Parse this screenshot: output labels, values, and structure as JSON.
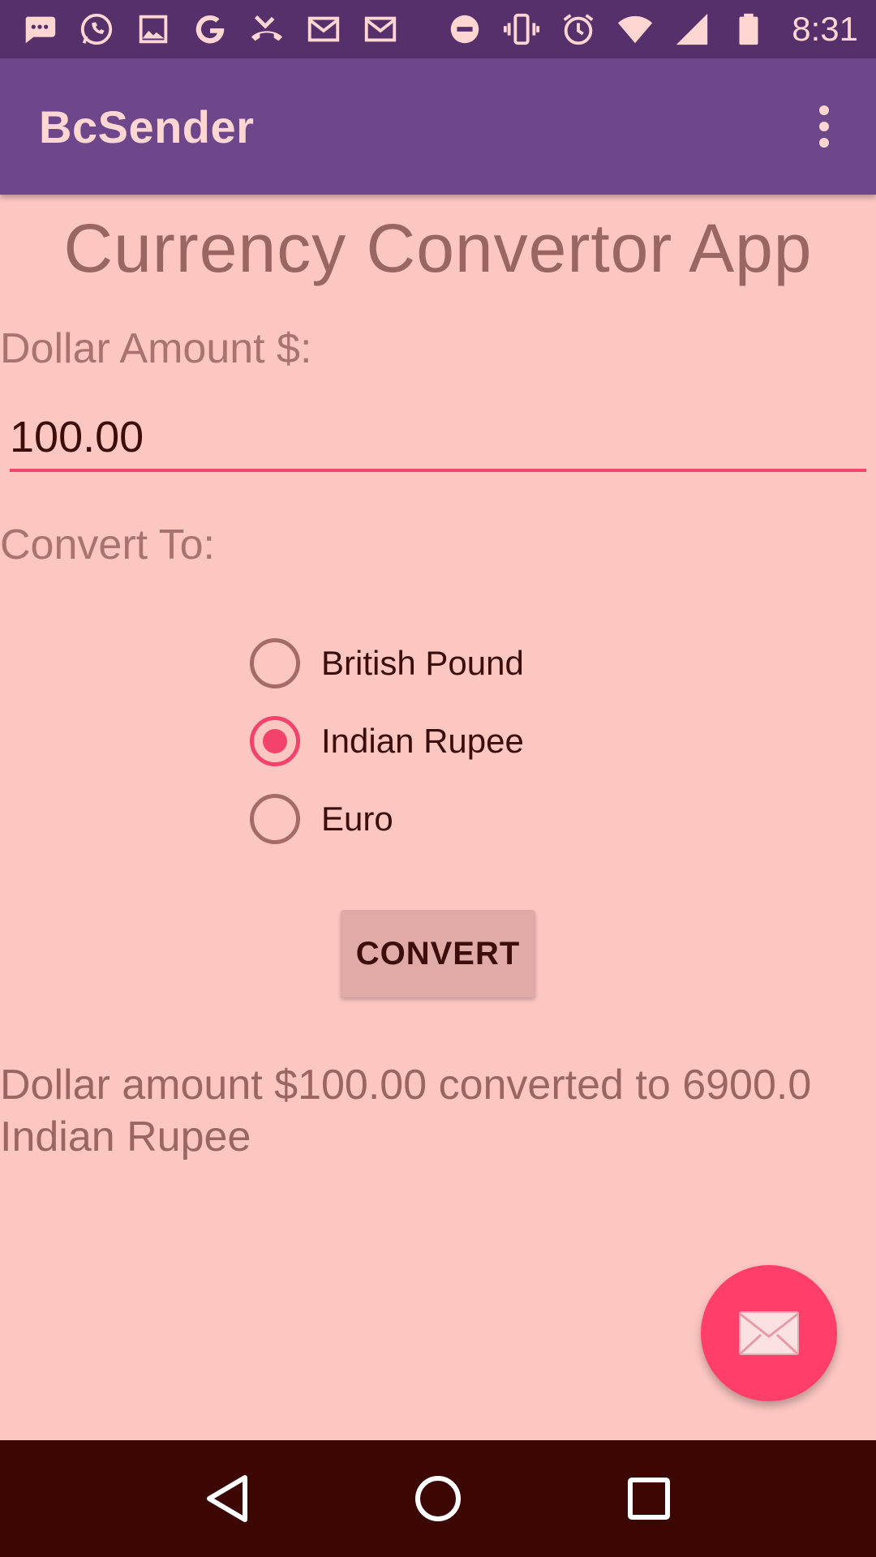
{
  "status_bar": {
    "time": "8:31",
    "left_icons": [
      "messages-icon",
      "whatsapp-icon",
      "gallery-icon",
      "google-icon",
      "missed-call-icon",
      "gmail-icon",
      "gmail-icon-2"
    ],
    "right_icons": [
      "do-not-disturb-icon",
      "vibrate-icon",
      "alarm-icon",
      "wifi-icon",
      "signal-icon",
      "battery-icon"
    ]
  },
  "app_bar": {
    "title": "BcSender",
    "overflow_icon": "more-vert-icon"
  },
  "main": {
    "heading": "Currency Convertor App",
    "amount_label": "Dollar Amount $:",
    "amount_value": "100.00",
    "convert_to_label": "Convert To:",
    "currency_options": [
      {
        "label": "British Pound",
        "checked": false
      },
      {
        "label": "Indian Rupee",
        "checked": true
      },
      {
        "label": "Euro",
        "checked": false
      }
    ],
    "convert_button": "CONVERT",
    "result": "Dollar amount $100.00 converted to 6900.0 Indian Rupee"
  },
  "fab": {
    "icon": "mail-icon"
  },
  "nav_bar": {
    "icons": [
      "back-icon",
      "home-icon",
      "recents-icon"
    ]
  },
  "colors": {
    "status_bar": "#56306a",
    "app_bar": "#6d4789",
    "background": "#fcc6c1",
    "accent": "#f3426b",
    "nav_bar": "#3c0703"
  }
}
